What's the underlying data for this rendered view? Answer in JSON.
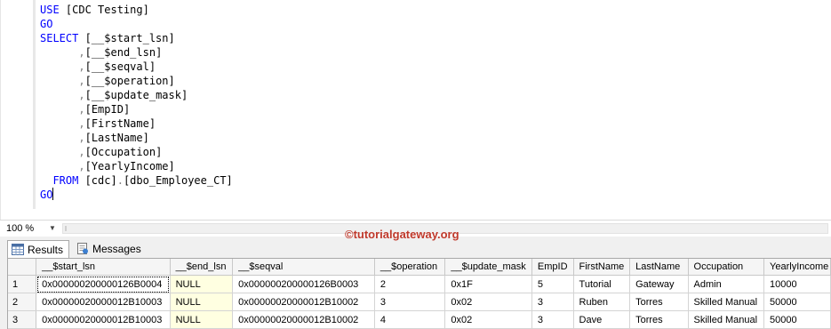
{
  "editor": {
    "lines": [
      [
        {
          "t": "USE",
          "c": "kw"
        },
        {
          "t": " [CDC Testing]"
        }
      ],
      [
        {
          "t": "GO",
          "c": "kw"
        }
      ],
      [
        {
          "t": "SELECT",
          "c": "kw"
        },
        {
          "t": " [__$start_lsn]"
        }
      ],
      [
        {
          "t": "      "
        },
        {
          "t": ",",
          "c": "gr"
        },
        {
          "t": "[__$end_lsn]"
        }
      ],
      [
        {
          "t": "      "
        },
        {
          "t": ",",
          "c": "gr"
        },
        {
          "t": "[__$seqval]"
        }
      ],
      [
        {
          "t": "      "
        },
        {
          "t": ",",
          "c": "gr"
        },
        {
          "t": "[__$operation]"
        }
      ],
      [
        {
          "t": "      "
        },
        {
          "t": ",",
          "c": "gr"
        },
        {
          "t": "[__$update_mask]"
        }
      ],
      [
        {
          "t": "      "
        },
        {
          "t": ",",
          "c": "gr"
        },
        {
          "t": "[EmpID]"
        }
      ],
      [
        {
          "t": "      "
        },
        {
          "t": ",",
          "c": "gr"
        },
        {
          "t": "[FirstName]"
        }
      ],
      [
        {
          "t": "      "
        },
        {
          "t": ",",
          "c": "gr"
        },
        {
          "t": "[LastName]"
        }
      ],
      [
        {
          "t": "      "
        },
        {
          "t": ",",
          "c": "gr"
        },
        {
          "t": "[Occupation]"
        }
      ],
      [
        {
          "t": "      "
        },
        {
          "t": ",",
          "c": "gr"
        },
        {
          "t": "[YearlyIncome]"
        }
      ],
      [
        {
          "t": "  "
        },
        {
          "t": "FROM",
          "c": "kw"
        },
        {
          "t": " [cdc]"
        },
        {
          "t": ".",
          "c": "gr"
        },
        {
          "t": "[dbo_Employee_CT]"
        }
      ],
      [
        {
          "t": "GO",
          "c": "kw"
        },
        {
          "caret": true
        }
      ]
    ]
  },
  "zoom": {
    "value": "100 %"
  },
  "watermark": "©tutorialgateway.org",
  "tabs": {
    "results": "Results",
    "messages": "Messages"
  },
  "grid": {
    "columns": [
      "__$start_lsn",
      "__$end_lsn",
      "__$seqval",
      "__$operation",
      "__$update_mask",
      "EmpID",
      "FirstName",
      "LastName",
      "Occupation",
      "YearlyIncome"
    ],
    "rows": [
      {
        "num": "1",
        "cells": [
          "0x000000200000126B0004",
          "NULL",
          "0x000000200000126B0003",
          "2",
          "0x1F",
          "5",
          "Tutorial",
          "Gateway",
          "Admin",
          "10000"
        ]
      },
      {
        "num": "2",
        "cells": [
          "0x00000020000012B10003",
          "NULL",
          "0x00000020000012B10002",
          "3",
          "0x02",
          "3",
          "Ruben",
          "Torres",
          "Skilled Manual",
          "50000"
        ]
      },
      {
        "num": "3",
        "cells": [
          "0x00000020000012B10003",
          "NULL",
          "0x00000020000012B10002",
          "4",
          "0x02",
          "3",
          "Dave",
          "Torres",
          "Skilled Manual",
          "50000"
        ]
      }
    ]
  },
  "colors": {
    "keyword": "#0000ff",
    "punctuation": "#808080",
    "null_cell_bg": "#ffffe1",
    "watermark": "#c0392b"
  }
}
